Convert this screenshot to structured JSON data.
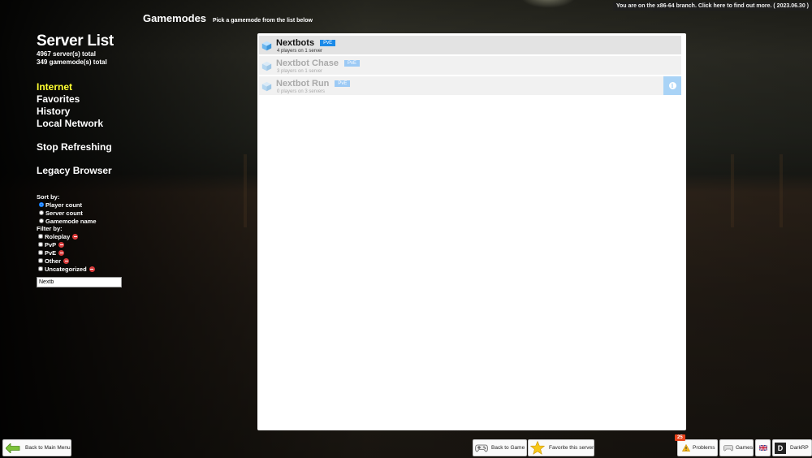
{
  "branch_notice": "You are on the x86-64 branch. Click here to find out more. ( 2023.06.30 )",
  "sidebar": {
    "title": "Server List",
    "servers_total": "4967 server(s) total",
    "gamemodes_total": "349 gamemode(s) total",
    "nav": {
      "internet": "Internet",
      "favorites": "Favorites",
      "history": "History",
      "local_network": "Local Network",
      "stop_refreshing": "Stop Refreshing",
      "legacy_browser": "Legacy Browser"
    },
    "sort_by_label": "Sort by:",
    "sort_options": {
      "player_count": "Player count",
      "server_count": "Server count",
      "gamemode_name": "Gamemode name"
    },
    "sort_selected": "Player count",
    "filter_by_label": "Filter by:",
    "filters": {
      "roleplay": "Roleplay",
      "pvp": "PvP",
      "pve": "PvE",
      "other": "Other",
      "uncategorized": "Uncategorized"
    },
    "search_value": "Nextb"
  },
  "header": {
    "title": "Gamemodes",
    "subtitle": "Pick a gamemode from the list below"
  },
  "gamemodes": [
    {
      "name": "Nextbots",
      "tag": "PvE",
      "players": "4 players on 1 server"
    },
    {
      "name": "Nextbot Chase",
      "tag": "PvE",
      "players": "3 players on 1 server"
    },
    {
      "name": "Nextbot Run",
      "tag": "PvE",
      "players": "0 players on 3 servers"
    }
  ],
  "bottom_bar": {
    "back_main_menu": "Back to Main Menu",
    "back_to_game": "Back to Game",
    "favorite_server": "Favorite this server",
    "problems_count": "25",
    "problems": "Problems",
    "games": "Games",
    "gamemode_letter": "D",
    "gamemode": "DarkRP"
  },
  "colors": {
    "active_nav": "#ffff30",
    "badge": "#1b8ae8",
    "problems_badge": "#e8431c",
    "info_button": "#a9d3f6"
  }
}
